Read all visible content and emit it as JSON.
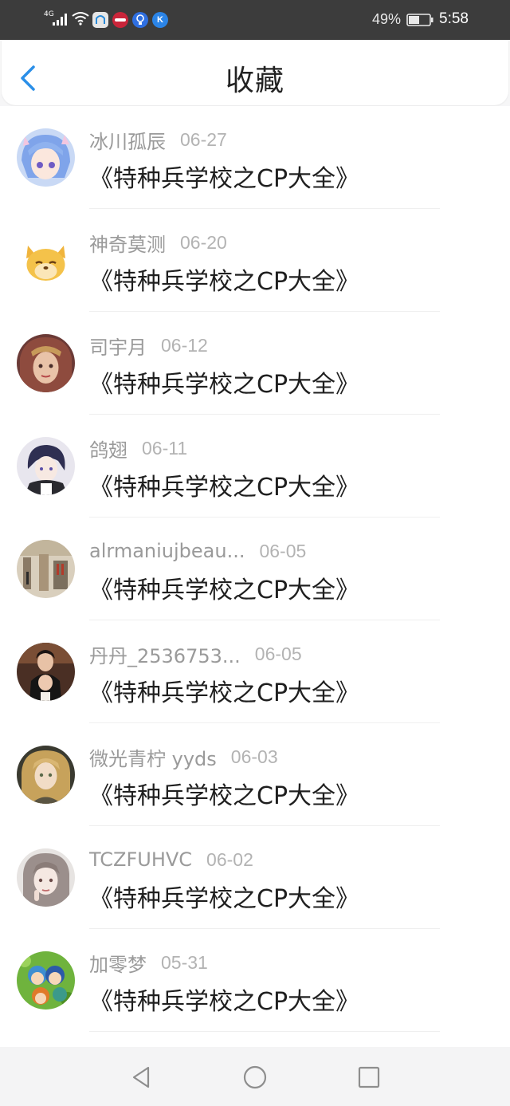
{
  "status_bar": {
    "network": "4G",
    "battery": "49%",
    "time": "5:58",
    "icons": [
      "signal-icon",
      "wifi-icon",
      "app-notification-icon",
      "app-notification-icon",
      "app-notification-icon",
      "app-notification-icon",
      "battery-icon"
    ]
  },
  "header": {
    "title": "收藏",
    "back_icon": "back-arrow-icon",
    "accent_color": "#2b8fe8"
  },
  "favorites": [
    {
      "user": "冰川孤辰",
      "date": "06-27",
      "title": "《特种兵学校之CP大全》"
    },
    {
      "user": "神奇莫测",
      "date": "06-20",
      "title": "《特种兵学校之CP大全》"
    },
    {
      "user": "司宇月",
      "date": "06-12",
      "title": "《特种兵学校之CP大全》"
    },
    {
      "user": "鸽翅",
      "date": "06-11",
      "title": "《特种兵学校之CP大全》"
    },
    {
      "user": "alrmaniujbeau...",
      "date": "06-05",
      "title": "《特种兵学校之CP大全》"
    },
    {
      "user": "丹丹_2536753...",
      "date": "06-05",
      "title": "《特种兵学校之CP大全》"
    },
    {
      "user": "微光青柠 yyds",
      "date": "06-03",
      "title": "《特种兵学校之CP大全》"
    },
    {
      "user": "TCZFUHVC",
      "date": "06-02",
      "title": "《特种兵学校之CP大全》"
    },
    {
      "user": "加零梦",
      "date": "05-31",
      "title": "《特种兵学校之CP大全》"
    }
  ],
  "nav_bar": {
    "icons": [
      "nav-back-icon",
      "nav-home-icon",
      "nav-recent-apps-icon"
    ]
  }
}
